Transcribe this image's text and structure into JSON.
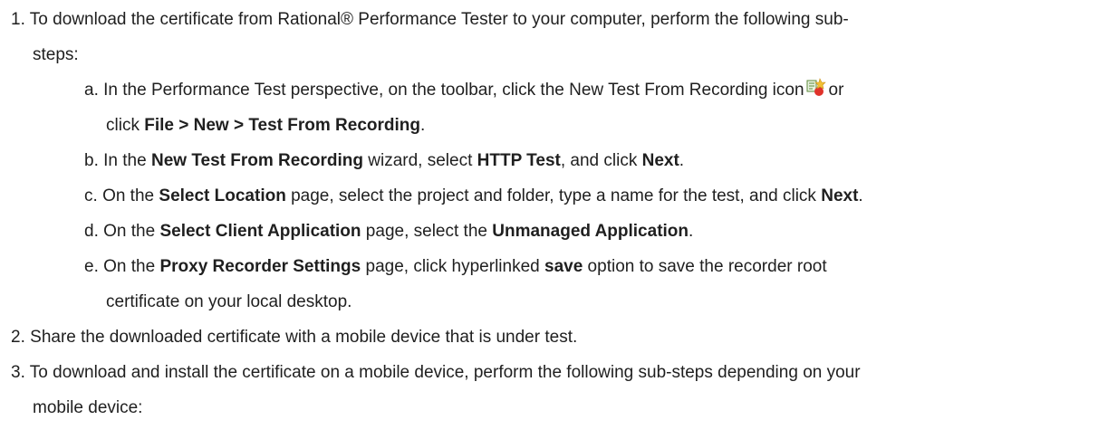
{
  "steps": [
    {
      "num": "1.",
      "text_a": "To download the certificate from  Rational® Performance Tester to your computer, perform the following sub-",
      "text_b": "steps:",
      "substeps": [
        {
          "letter": "a.",
          "p1": "In the Performance Test perspective, on the toolbar, click the New Test From Recording icon",
          "p2": "or",
          "p3": "click ",
          "b1": "File > New > Test From Recording",
          "p4": "."
        },
        {
          "letter": "b.",
          "p1": "In the ",
          "b1": "New Test From Recording",
          "p2": " wizard, select ",
          "b2": "HTTP Test",
          "p3": ", and click ",
          "b3": "Next",
          "p4": "."
        },
        {
          "letter": "c.",
          "p1": "On the ",
          "b1": "Select Location",
          "p2": " page, select the project and folder, type a name for the test, and click ",
          "b2": "Next",
          "p3": "."
        },
        {
          "letter": "d.",
          "p1": "On the ",
          "b1": "Select Client Application",
          "p2": " page, select the ",
          "b2": "Unmanaged Application",
          "p3": "."
        },
        {
          "letter": "e.",
          "p1": "On the ",
          "b1": "Proxy Recorder Settings",
          "p2": " page, click hyperlinked ",
          "b2": "save",
          "p3": " option to save the recorder root",
          "p4": "certificate on your local desktop."
        }
      ]
    },
    {
      "num": "2.",
      "text_a": "Share the downloaded certificate with a mobile device that is under test."
    },
    {
      "num": "3.",
      "text_a": "To download and install the certificate on a mobile device, perform the following sub-steps depending on your",
      "text_b": "mobile device:"
    }
  ],
  "icons": {
    "new_test_icon": "new-test-from-recording-icon"
  }
}
